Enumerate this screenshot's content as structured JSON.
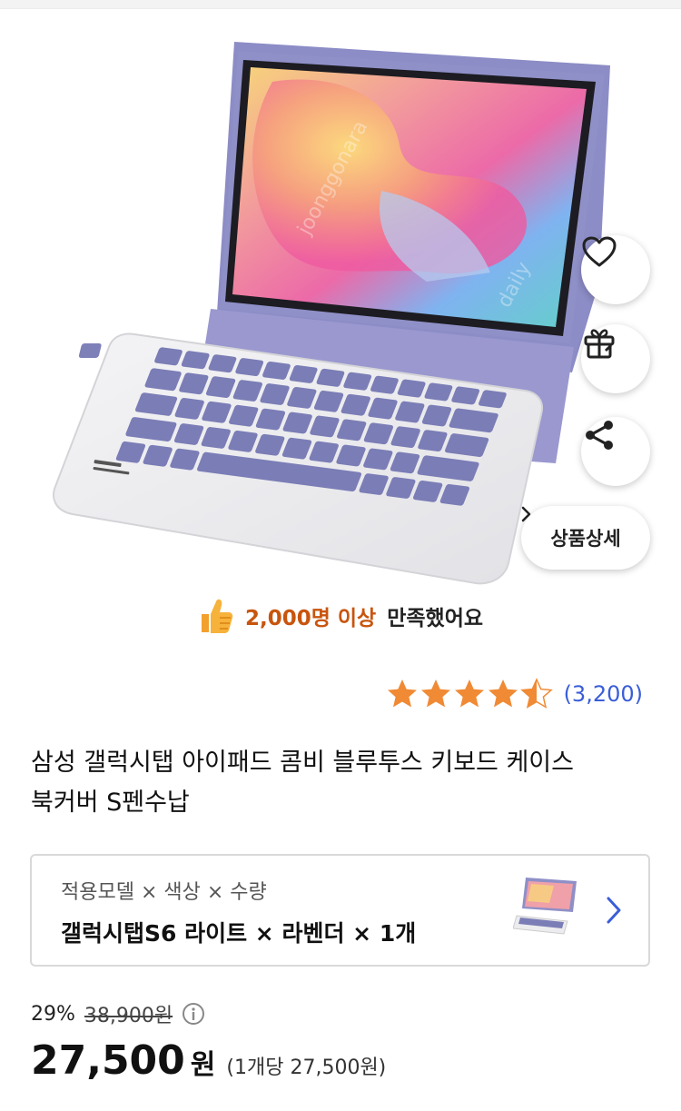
{
  "actions": {
    "detail_label": "상품상세",
    "like_icon": "heart-icon",
    "gift_icon": "gift-icon",
    "share_icon": "share-icon"
  },
  "satisfaction": {
    "highlight": "2,000명 이상",
    "rest": "만족했어요",
    "icon": "thumbs-up-icon"
  },
  "rating": {
    "stars": 4.5,
    "max": 5,
    "count_text": "(3,200)",
    "star_color": "#f08a34"
  },
  "product": {
    "title_line1": "삼성 갤럭시탭 아이패드 콤비 블루투스 키보드 케이스",
    "title_line2": "북커버 S펜수납"
  },
  "option": {
    "label": "적용모델 × 색상 × 수량",
    "value": "갤럭시탭S6 라이트 × 라벤더 × 1개"
  },
  "price": {
    "discount": "29%",
    "original": "38,900원",
    "amount": "27,500",
    "currency": "원",
    "unit_price": "(1개당 27,500원)"
  },
  "colors": {
    "accent_blue": "#3a5ed8",
    "satisfaction_orange": "#c8550e",
    "case_lavender": "#8f8fc8"
  }
}
